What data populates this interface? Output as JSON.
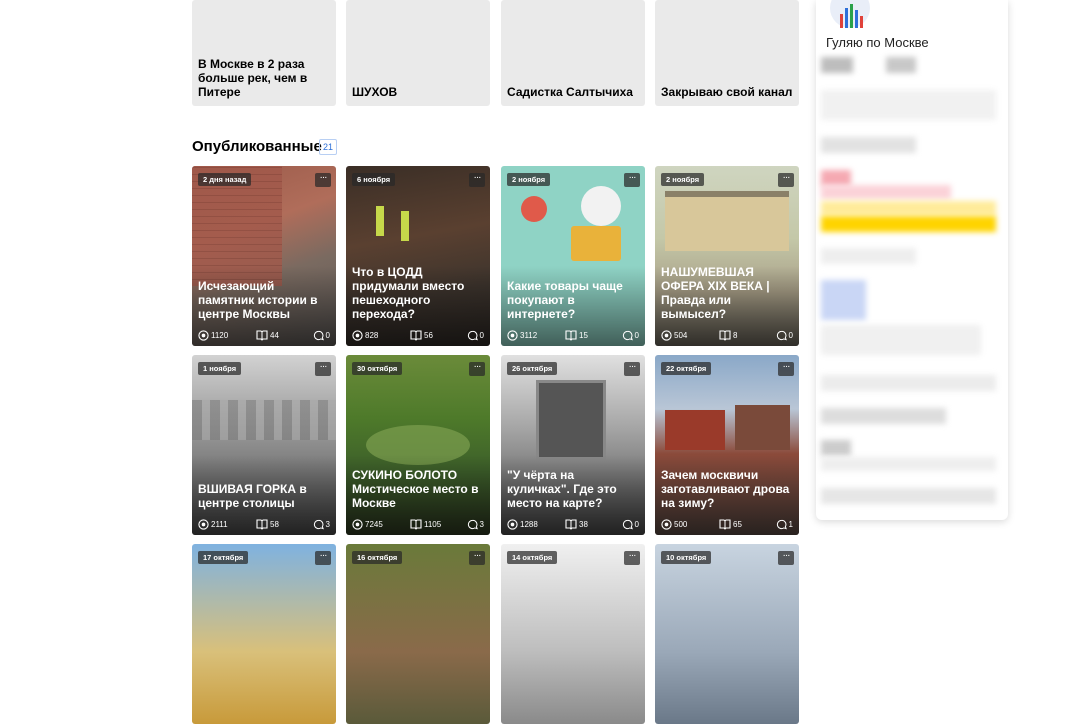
{
  "drafts": [
    {
      "title": "В Москве в 2 раза больше рек, чем в Питере"
    },
    {
      "title": "ШУХОВ"
    },
    {
      "title": "Садистка Салтычиха"
    },
    {
      "title": "Закрываю свой канал"
    }
  ],
  "published": {
    "title": "Опубликованные",
    "count": "21"
  },
  "cards": [
    {
      "date": "2 дня назад",
      "title": "Исчезающий памятник истории в центре Москвы",
      "views": "1120",
      "reads": "44",
      "comments": "0"
    },
    {
      "date": "6 ноября",
      "title": "Что в ЦОДД придумали вместо пешеходного перехода?",
      "views": "828",
      "reads": "56",
      "comments": "0"
    },
    {
      "date": "2 ноября",
      "title": "Какие товары чаще покупают в интернете?",
      "views": "3112",
      "reads": "15",
      "comments": "0"
    },
    {
      "date": "2 ноября",
      "title": "НАШУМЕВШАЯ ОФЕРА XIX ВЕКА | Правда или вымысел?",
      "views": "504",
      "reads": "8",
      "comments": "0"
    },
    {
      "date": "1 ноября",
      "title": "ВШИВАЯ ГОРКА в центре столицы",
      "views": "2111",
      "reads": "58",
      "comments": "3"
    },
    {
      "date": "30 октября",
      "title": "СУКИНО БОЛОТО Мистическое место в Москве",
      "views": "7245",
      "reads": "1105",
      "comments": "3"
    },
    {
      "date": "26 октября",
      "title": "\"У чёрта на куличках\". Где это место на карте?",
      "views": "1288",
      "reads": "38",
      "comments": "0"
    },
    {
      "date": "22 октября",
      "title": "Зачем москвичи заготавливают дрова на зиму?",
      "views": "500",
      "reads": "65",
      "comments": "1"
    },
    {
      "date": "17 октября",
      "title": "",
      "views": "",
      "reads": "",
      "comments": ""
    },
    {
      "date": "16 октября",
      "title": "",
      "views": "",
      "reads": "",
      "comments": ""
    },
    {
      "date": "14 октября",
      "title": "",
      "views": "",
      "reads": "",
      "comments": ""
    },
    {
      "date": "10 октября",
      "title": "",
      "views": "",
      "reads": "",
      "comments": ""
    }
  ],
  "channel": {
    "name": "Гуляю по Москве"
  },
  "icons": {
    "views": "eye-icon",
    "reads": "book-icon",
    "comments": "comment-icon",
    "more": "more-dots-icon"
  },
  "colors": {
    "accent_yellow": "#ffd400",
    "pink": "#f9c6cc",
    "blue": "#c9d6f5"
  }
}
